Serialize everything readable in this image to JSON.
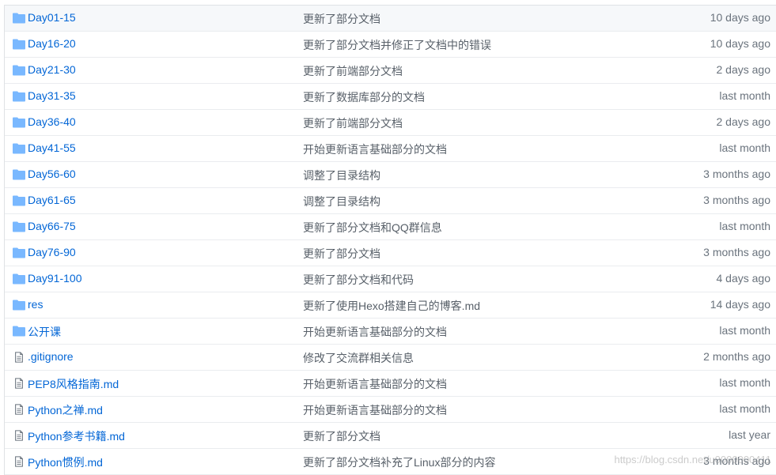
{
  "colors": {
    "link": "#0366d6",
    "folder_icon": "#79b8ff",
    "file_icon": "#6a737d",
    "border": "#eaecef"
  },
  "files": [
    {
      "type": "folder",
      "icon": "folder-icon",
      "name": "Day01-15",
      "message": "更新了部分文档",
      "age": "10 days ago"
    },
    {
      "type": "folder",
      "icon": "folder-icon",
      "name": "Day16-20",
      "message": "更新了部分文档并修正了文档中的错误",
      "age": "10 days ago"
    },
    {
      "type": "folder",
      "icon": "folder-icon",
      "name": "Day21-30",
      "message": "更新了前端部分文档",
      "age": "2 days ago"
    },
    {
      "type": "folder",
      "icon": "folder-icon",
      "name": "Day31-35",
      "message": "更新了数据库部分的文档",
      "age": "last month"
    },
    {
      "type": "folder",
      "icon": "folder-icon",
      "name": "Day36-40",
      "message": "更新了前端部分文档",
      "age": "2 days ago"
    },
    {
      "type": "folder",
      "icon": "folder-icon",
      "name": "Day41-55",
      "message": "开始更新语言基础部分的文档",
      "age": "last month"
    },
    {
      "type": "folder",
      "icon": "folder-icon",
      "name": "Day56-60",
      "message": "调整了目录结构",
      "age": "3 months ago"
    },
    {
      "type": "folder",
      "icon": "folder-icon",
      "name": "Day61-65",
      "message": "调整了目录结构",
      "age": "3 months ago"
    },
    {
      "type": "folder",
      "icon": "folder-icon",
      "name": "Day66-75",
      "message": "更新了部分文档和QQ群信息",
      "age": "last month"
    },
    {
      "type": "folder",
      "icon": "folder-icon",
      "name": "Day76-90",
      "message": "更新了部分文档",
      "age": "3 months ago"
    },
    {
      "type": "folder",
      "icon": "folder-icon",
      "name": "Day91-100",
      "message": "更新了部分文档和代码",
      "age": "4 days ago"
    },
    {
      "type": "folder",
      "icon": "folder-icon",
      "name": "res",
      "message": "更新了使用Hexo搭建自己的博客.md",
      "age": "14 days ago"
    },
    {
      "type": "folder",
      "icon": "folder-icon",
      "name": "公开课",
      "message": "开始更新语言基础部分的文档",
      "age": "last month"
    },
    {
      "type": "file",
      "icon": "file-icon",
      "name": ".gitignore",
      "message": "修改了交流群相关信息",
      "age": "2 months ago"
    },
    {
      "type": "file",
      "icon": "file-icon",
      "name": "PEP8风格指南.md",
      "message": "开始更新语言基础部分的文档",
      "age": "last month"
    },
    {
      "type": "file",
      "icon": "file-icon",
      "name": "Python之禅.md",
      "message": "开始更新语言基础部分的文档",
      "age": "last month"
    },
    {
      "type": "file",
      "icon": "file-icon",
      "name": "Python参考书籍.md",
      "message": "更新了部分文档",
      "age": "last year"
    },
    {
      "type": "file",
      "icon": "file-icon",
      "name": "Python惯例.md",
      "message": "更新了部分文档补充了Linux部分的内容",
      "age": "3 months ago"
    }
  ],
  "watermark": "https://blog.csdn.net/u0000000411"
}
